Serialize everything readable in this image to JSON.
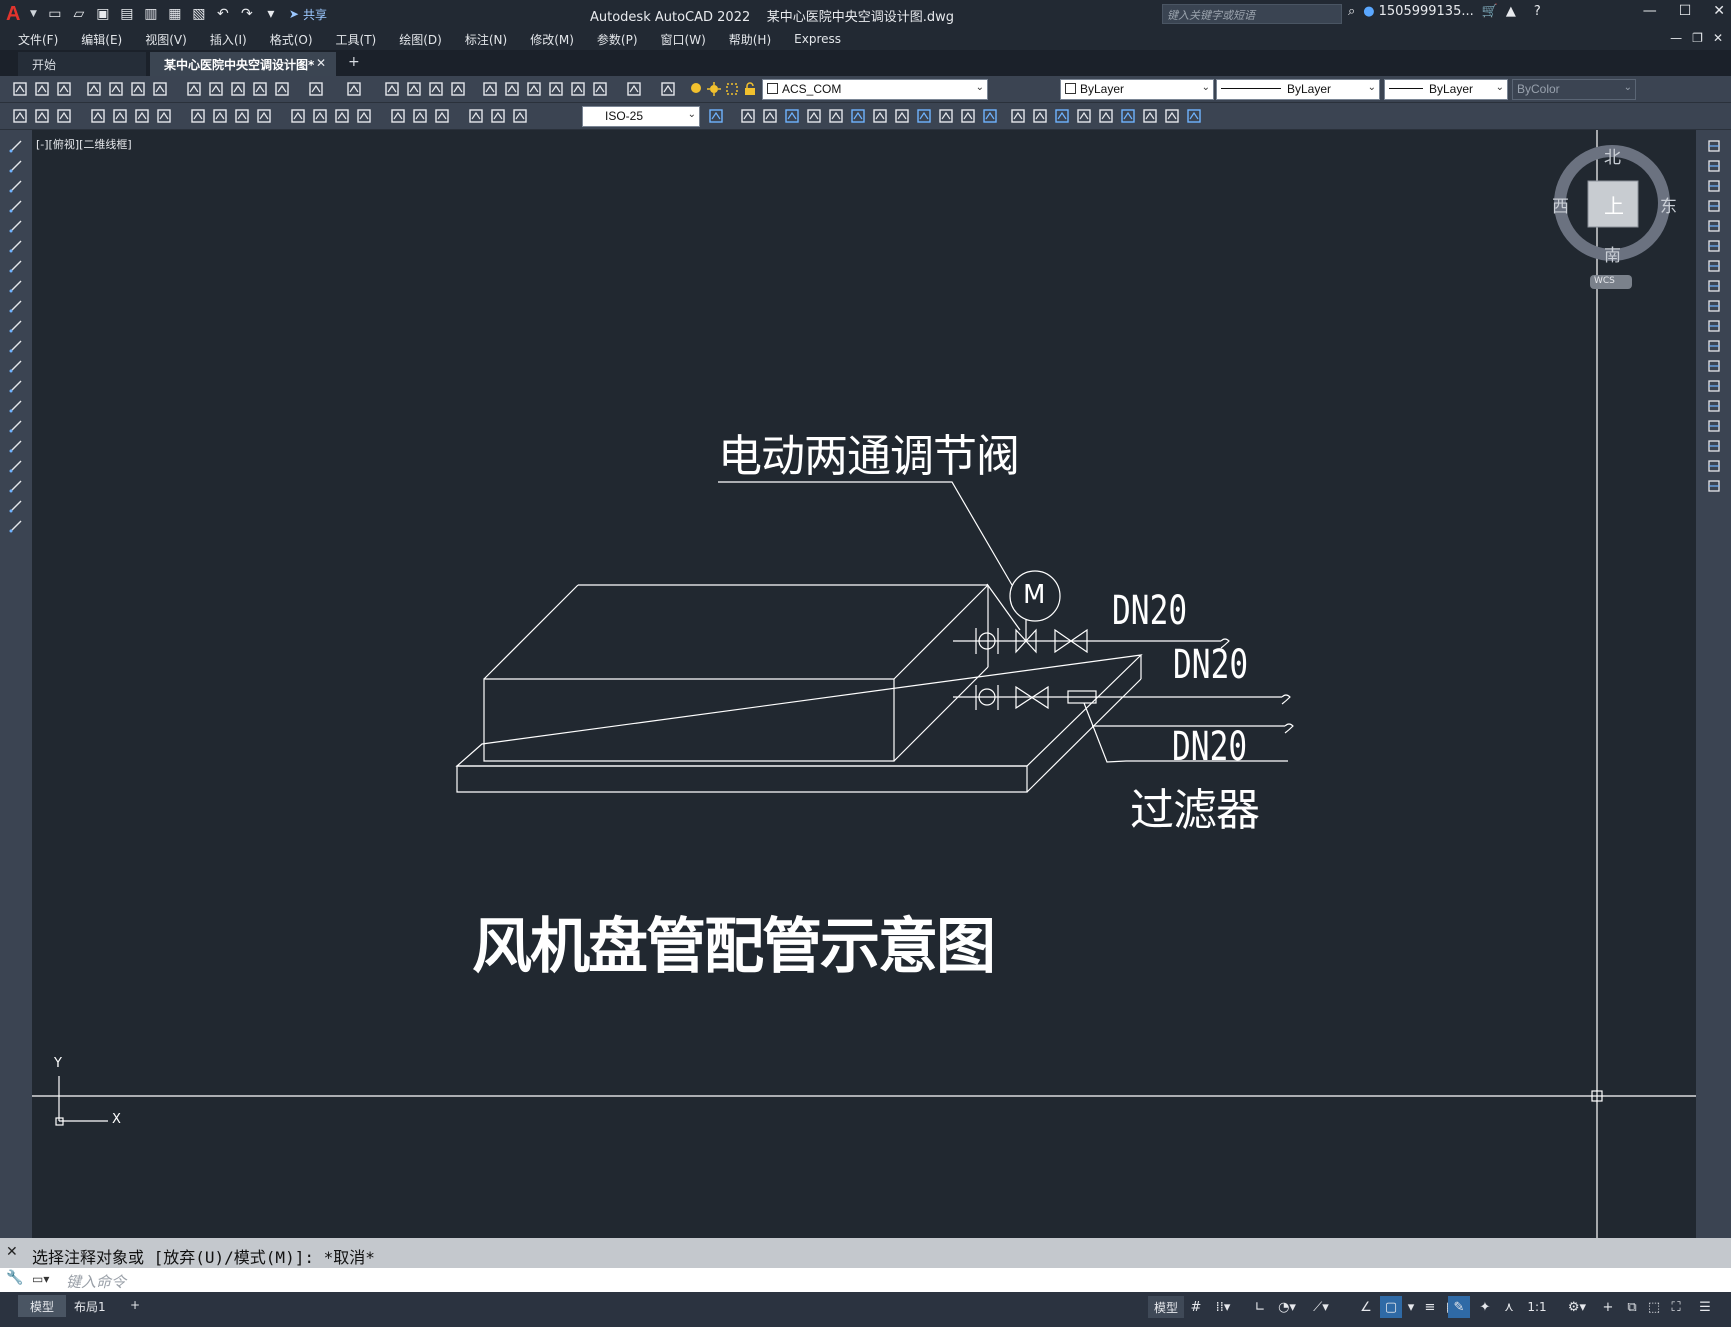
{
  "app": {
    "title": "Autodesk AutoCAD 2022    某中心医院中央空调设计图.dwg",
    "logo_letter": "A",
    "share_label": "共享",
    "search_placeholder": "键入关键字或短语",
    "user": "1505999135...",
    "window_buttons": [
      "—",
      "☐",
      "✕"
    ],
    "mdi_buttons": [
      "—",
      "❐",
      "✕"
    ]
  },
  "menu": {
    "items": [
      "文件(F)",
      "编辑(E)",
      "视图(V)",
      "插入(I)",
      "格式(O)",
      "工具(T)",
      "绘图(D)",
      "标注(N)",
      "修改(M)",
      "参数(P)",
      "窗口(W)",
      "帮助(H)",
      "Express"
    ]
  },
  "tabs": {
    "start": "开始",
    "active": "某中心医院中央空调设计图*",
    "close": "✕",
    "add": "+"
  },
  "toolbar": {
    "layer_name": "ACS_COM",
    "color": "ByLayer",
    "linetype": "ByLayer",
    "lineweight": "ByLayer",
    "plotstyle": "ByColor",
    "dim_style": "ISO-25"
  },
  "viewport": {
    "label": "[-][俯视][二维线框]"
  },
  "viewcube": {
    "north": "北",
    "south": "南",
    "east": "东",
    "west": "西",
    "top": "上",
    "wcs": "WCS"
  },
  "drawing": {
    "label_valve": "电动两通调节阀",
    "label_motor": "M",
    "label_dn_1": "DN20",
    "label_dn_2": "DN20",
    "label_dn_3": "DN20",
    "label_filter": "过滤器",
    "title": "风机盘管配管示意图",
    "ucs_x": "X",
    "ucs_y": "Y"
  },
  "command": {
    "history": "选择注释对象或 [放弃(U)/模式(M)]: *取消*",
    "placeholder": "键入命令"
  },
  "status": {
    "layouts": [
      "模型",
      "布局1"
    ],
    "add_layout": "+",
    "model_label": "模型",
    "scale": "1:1"
  },
  "colors": {
    "background": "#212830",
    "chrome": "#3b4452",
    "line": "#ffffff",
    "accent": "#2f6aa6"
  }
}
